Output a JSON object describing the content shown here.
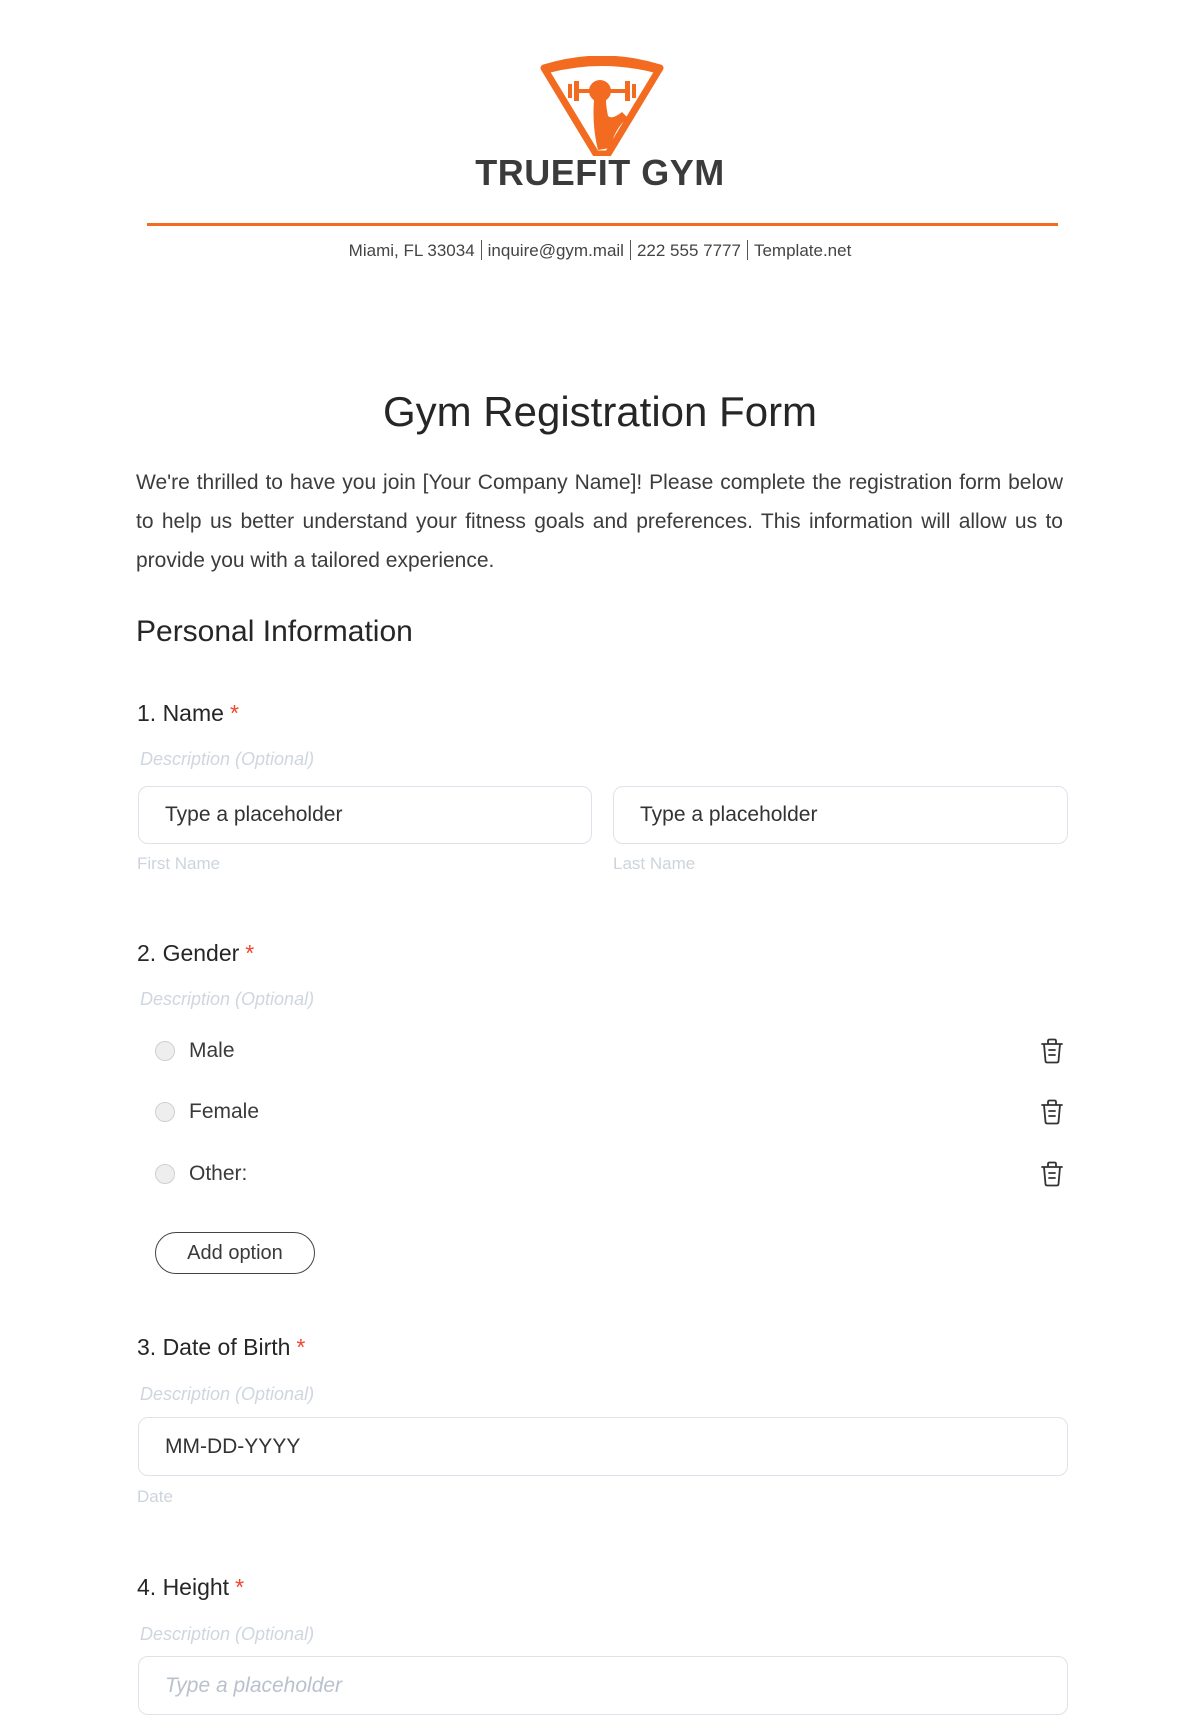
{
  "header": {
    "brand": "TRUEFIT GYM",
    "logo_icon": "shield-dumbbell-logo-icon",
    "contact": [
      "Miami, FL 33034",
      "inquire@gym.mail",
      "222 555 7777",
      "Template.net"
    ]
  },
  "colors": {
    "accent": "#f26b21",
    "required": "#f2452b",
    "text": "#262626",
    "muted": "#cfd6df"
  },
  "form": {
    "title": "Gym Registration Form",
    "intro": "We're thrilled to have you join [Your Company Name]! Please complete the registration form below to help us better understand your fitness goals and preferences. This information will allow us to provide you with a tailored experience.",
    "section": "Personal Information",
    "questions": [
      {
        "label": "1. Name",
        "required": "*",
        "description": "Description (Optional)",
        "fields": [
          {
            "placeholder": "Type a placeholder",
            "sublabel": "First Name"
          },
          {
            "placeholder": "Type a placeholder",
            "sublabel": "Last Name"
          }
        ]
      },
      {
        "label": "2. Gender",
        "required": "*",
        "description": "Description (Optional)",
        "options": [
          "Male",
          "Female",
          "Other:"
        ],
        "option_action_icon": "trash-icon",
        "add_option_label": "Add option"
      },
      {
        "label": "3. Date of Birth",
        "required": "*",
        "description": "Description (Optional)",
        "fields": [
          {
            "placeholder": "MM-DD-YYYY",
            "sublabel": "Date"
          }
        ]
      },
      {
        "label": "4. Height",
        "required": "*",
        "description": "Description (Optional)",
        "fields": [
          {
            "placeholder": "Type a placeholder"
          }
        ]
      }
    ]
  }
}
